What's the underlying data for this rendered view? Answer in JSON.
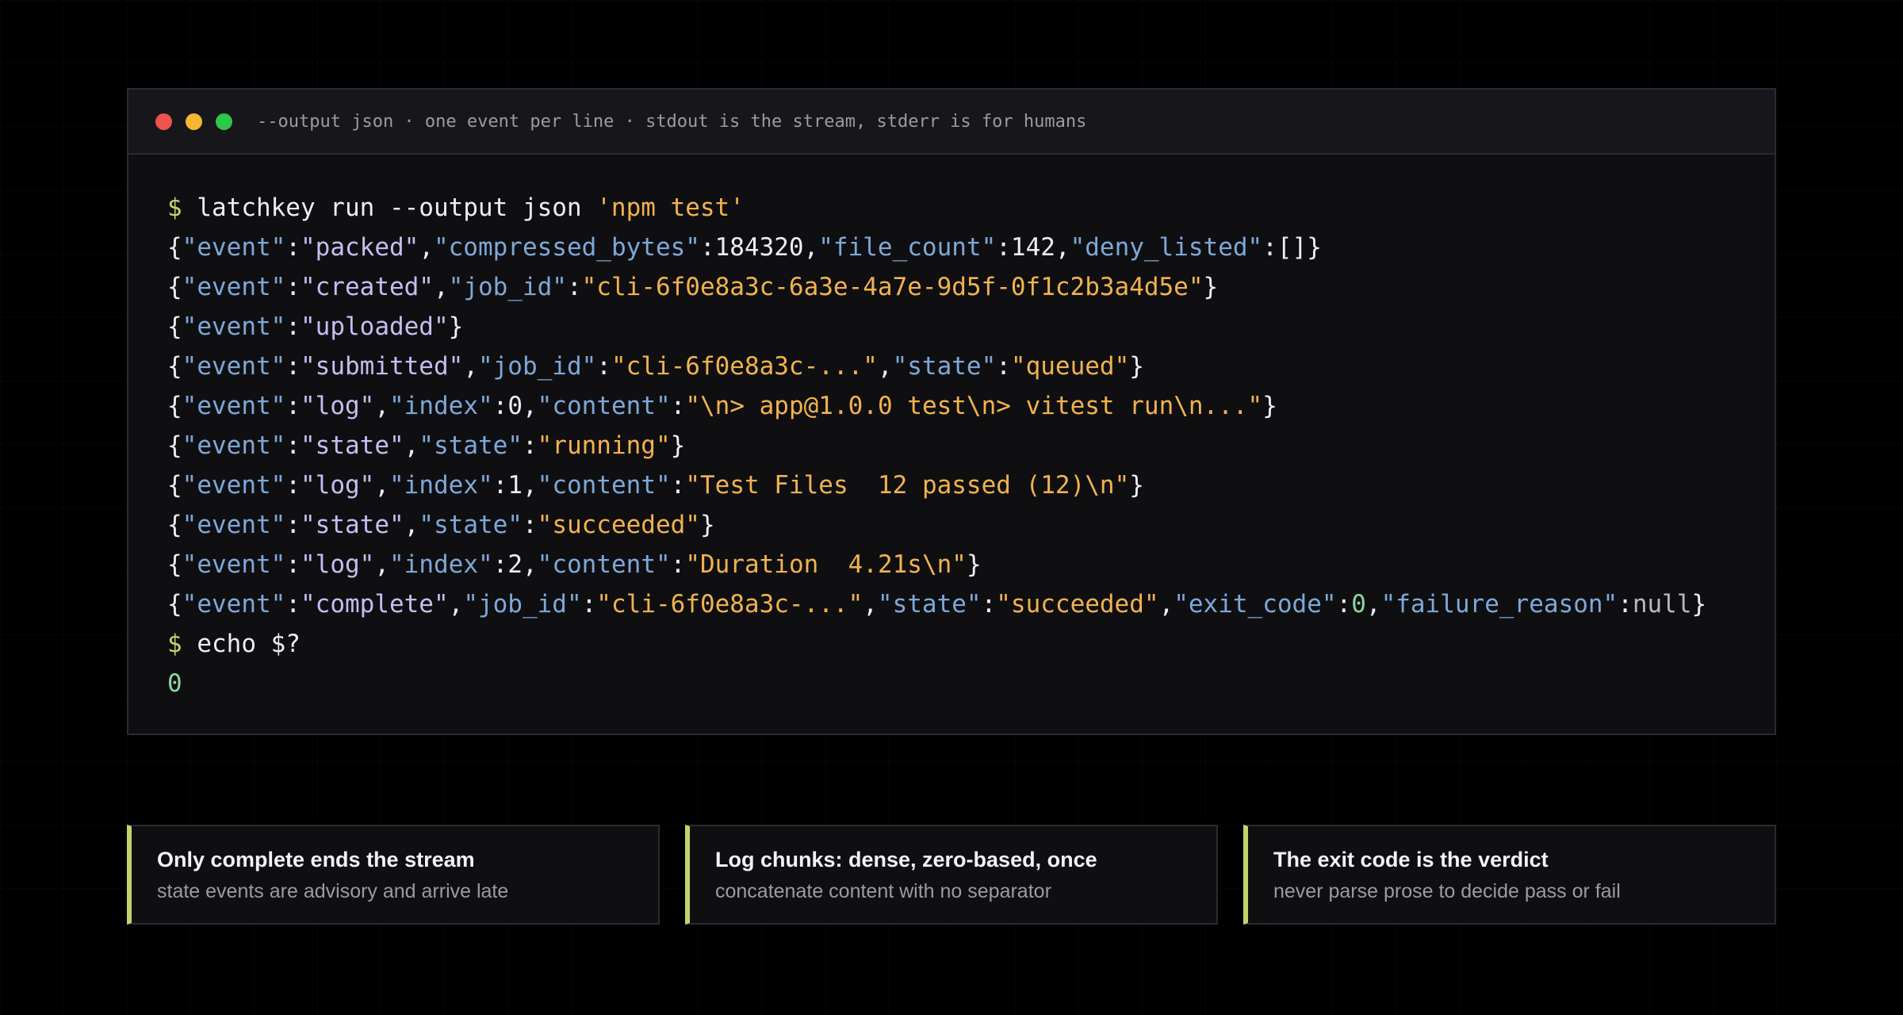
{
  "window": {
    "title": "--output json · one event per line · stdout is the stream, stderr is for humans"
  },
  "colors": {
    "prompt": "#c3d46a",
    "command": "#eceef2",
    "punct": "#eceef2",
    "key": "#7ea8d8",
    "event_value": "#c8bcf0",
    "string": "#f2b24e",
    "number": "#eceef2",
    "zero": "#8fd6a0",
    "null": "#b8b9c0",
    "accent": "#c3d46a"
  },
  "terminal": {
    "lines": [
      [
        [
          "prompt",
          "$ "
        ],
        [
          "command",
          "latchkey run --output json "
        ],
        [
          "string",
          "'npm test'"
        ]
      ],
      [
        [
          "punct",
          "{"
        ],
        [
          "key",
          "\"event\""
        ],
        [
          "punct",
          ":"
        ],
        [
          "event_value",
          "\"packed\""
        ],
        [
          "punct",
          ","
        ],
        [
          "key",
          "\"compressed_bytes\""
        ],
        [
          "punct",
          ":"
        ],
        [
          "number",
          "184320"
        ],
        [
          "punct",
          ","
        ],
        [
          "key",
          "\"file_count\""
        ],
        [
          "punct",
          ":"
        ],
        [
          "number",
          "142"
        ],
        [
          "punct",
          ","
        ],
        [
          "key",
          "\"deny_listed\""
        ],
        [
          "punct",
          ":[]}"
        ]
      ],
      [
        [
          "punct",
          "{"
        ],
        [
          "key",
          "\"event\""
        ],
        [
          "punct",
          ":"
        ],
        [
          "event_value",
          "\"created\""
        ],
        [
          "punct",
          ","
        ],
        [
          "key",
          "\"job_id\""
        ],
        [
          "punct",
          ":"
        ],
        [
          "string",
          "\"cli-6f0e8a3c-6a3e-4a7e-9d5f-0f1c2b3a4d5e\""
        ],
        [
          "punct",
          "}"
        ]
      ],
      [
        [
          "punct",
          "{"
        ],
        [
          "key",
          "\"event\""
        ],
        [
          "punct",
          ":"
        ],
        [
          "event_value",
          "\"uploaded\""
        ],
        [
          "punct",
          "}"
        ]
      ],
      [
        [
          "punct",
          "{"
        ],
        [
          "key",
          "\"event\""
        ],
        [
          "punct",
          ":"
        ],
        [
          "event_value",
          "\"submitted\""
        ],
        [
          "punct",
          ","
        ],
        [
          "key",
          "\"job_id\""
        ],
        [
          "punct",
          ":"
        ],
        [
          "string",
          "\"cli-6f0e8a3c-...\""
        ],
        [
          "punct",
          ","
        ],
        [
          "key",
          "\"state\""
        ],
        [
          "punct",
          ":"
        ],
        [
          "string",
          "\"queued\""
        ],
        [
          "punct",
          "}"
        ]
      ],
      [
        [
          "punct",
          "{"
        ],
        [
          "key",
          "\"event\""
        ],
        [
          "punct",
          ":"
        ],
        [
          "event_value",
          "\"log\""
        ],
        [
          "punct",
          ","
        ],
        [
          "key",
          "\"index\""
        ],
        [
          "punct",
          ":"
        ],
        [
          "number",
          "0"
        ],
        [
          "punct",
          ","
        ],
        [
          "key",
          "\"content\""
        ],
        [
          "punct",
          ":"
        ],
        [
          "string",
          "\"\\n> app@1.0.0 test\\n> vitest run\\n...\""
        ],
        [
          "punct",
          "}"
        ]
      ],
      [
        [
          "punct",
          "{"
        ],
        [
          "key",
          "\"event\""
        ],
        [
          "punct",
          ":"
        ],
        [
          "event_value",
          "\"state\""
        ],
        [
          "punct",
          ","
        ],
        [
          "key",
          "\"state\""
        ],
        [
          "punct",
          ":"
        ],
        [
          "string",
          "\"running\""
        ],
        [
          "punct",
          "}"
        ]
      ],
      [
        [
          "punct",
          "{"
        ],
        [
          "key",
          "\"event\""
        ],
        [
          "punct",
          ":"
        ],
        [
          "event_value",
          "\"log\""
        ],
        [
          "punct",
          ","
        ],
        [
          "key",
          "\"index\""
        ],
        [
          "punct",
          ":"
        ],
        [
          "number",
          "1"
        ],
        [
          "punct",
          ","
        ],
        [
          "key",
          "\"content\""
        ],
        [
          "punct",
          ":"
        ],
        [
          "string",
          "\"Test Files  12 passed (12)\\n\""
        ],
        [
          "punct",
          "}"
        ]
      ],
      [
        [
          "punct",
          "{"
        ],
        [
          "key",
          "\"event\""
        ],
        [
          "punct",
          ":"
        ],
        [
          "event_value",
          "\"state\""
        ],
        [
          "punct",
          ","
        ],
        [
          "key",
          "\"state\""
        ],
        [
          "punct",
          ":"
        ],
        [
          "string",
          "\"succeeded\""
        ],
        [
          "punct",
          "}"
        ]
      ],
      [
        [
          "punct",
          "{"
        ],
        [
          "key",
          "\"event\""
        ],
        [
          "punct",
          ":"
        ],
        [
          "event_value",
          "\"log\""
        ],
        [
          "punct",
          ","
        ],
        [
          "key",
          "\"index\""
        ],
        [
          "punct",
          ":"
        ],
        [
          "number",
          "2"
        ],
        [
          "punct",
          ","
        ],
        [
          "key",
          "\"content\""
        ],
        [
          "punct",
          ":"
        ],
        [
          "string",
          "\"Duration  4.21s\\n\""
        ],
        [
          "punct",
          "}"
        ]
      ],
      [
        [
          "punct",
          "{"
        ],
        [
          "key",
          "\"event\""
        ],
        [
          "punct",
          ":"
        ],
        [
          "event_value",
          "\"complete\""
        ],
        [
          "punct",
          ","
        ],
        [
          "key",
          "\"job_id\""
        ],
        [
          "punct",
          ":"
        ],
        [
          "string",
          "\"cli-6f0e8a3c-...\""
        ],
        [
          "punct",
          ","
        ],
        [
          "key",
          "\"state\""
        ],
        [
          "punct",
          ":"
        ],
        [
          "string",
          "\"succeeded\""
        ],
        [
          "punct",
          ","
        ],
        [
          "key",
          "\"exit_code\""
        ],
        [
          "punct",
          ":"
        ],
        [
          "zero",
          "0"
        ],
        [
          "punct",
          ","
        ],
        [
          "key",
          "\"failure_reason\""
        ],
        [
          "punct",
          ":"
        ],
        [
          "null",
          "null"
        ],
        [
          "punct",
          "}"
        ]
      ],
      [
        [
          "prompt",
          "$ "
        ],
        [
          "command",
          "echo $?"
        ]
      ],
      [
        [
          "zero",
          "0"
        ]
      ]
    ]
  },
  "notes": [
    {
      "title": "Only complete ends the stream",
      "subtitle": "state events are advisory and arrive late"
    },
    {
      "title": "Log chunks: dense, zero-based, once",
      "subtitle": "concatenate content with no separator"
    },
    {
      "title": "The exit code is the verdict",
      "subtitle": "never parse prose to decide pass or fail"
    }
  ]
}
